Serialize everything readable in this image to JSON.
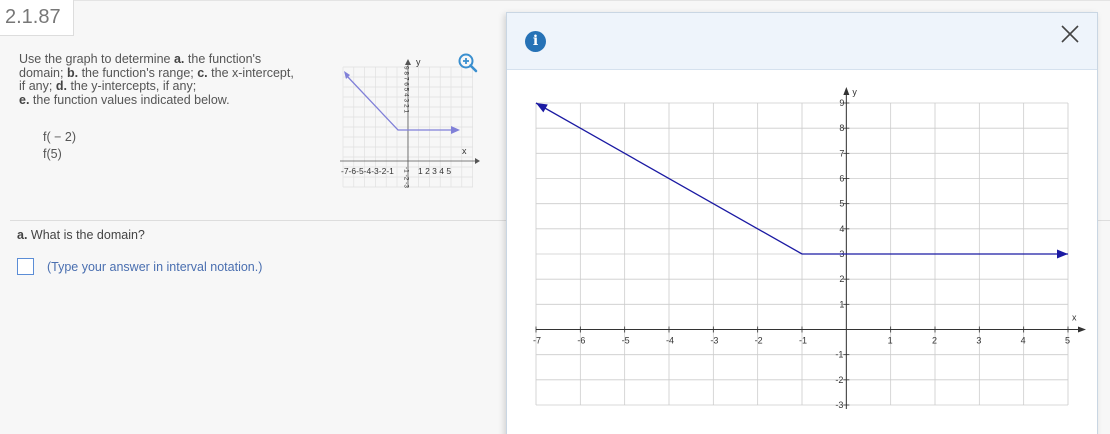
{
  "problem": {
    "number": "2.1.87"
  },
  "question": {
    "intro": "Use the graph to determine",
    "a_label": "a.",
    "a_text": "the function's domain;",
    "b_label": "b.",
    "b_text": "the function's range;",
    "c_label": "c.",
    "c_text": "the x-intercept, if any;",
    "d_label": "d.",
    "d_text": "the y-intercepts, if any;",
    "e_label": "e.",
    "e_text": "the function values indicated below.",
    "values": [
      "f( − 2)",
      "f(5)"
    ]
  },
  "part_a": {
    "label": "a.",
    "question": "What is the domain?",
    "hint": "(Type your answer in interval notation.)",
    "answer_value": ""
  },
  "icons": {
    "zoom": "zoom-in-icon",
    "info": "info-icon",
    "close": "close-icon"
  },
  "colors": {
    "line": "#1b1aa3",
    "thumb_line": "#8080d8",
    "accent": "#2672b6",
    "grid": "#cccccc"
  },
  "thumb_labels": {
    "x_label": "x",
    "y_label": "y",
    "x_ticks_neg": "-7-6-5-4-3-2-1",
    "x_ticks_pos": "1 2 3 4 5",
    "y_ticks_left": "9 8 7 6 5 4 3 2 1",
    "y_ticks_neg": "-1 -2 -3"
  },
  "chart_data": {
    "type": "line",
    "xlabel": "x",
    "ylabel": "y",
    "xlim": [
      -7,
      5
    ],
    "ylim": [
      -3,
      9
    ],
    "x_ticks": [
      "-7",
      "-6",
      "-5",
      "-4",
      "-3",
      "-2",
      "-1",
      "1",
      "2",
      "3",
      "4",
      "5"
    ],
    "y_ticks": [
      "9",
      "8",
      "7",
      "6",
      "5",
      "4",
      "3",
      "2",
      "1",
      "-1",
      "-2",
      "-3"
    ],
    "grid": true,
    "series": [
      {
        "points": [
          [
            -7,
            9
          ],
          [
            -1,
            3
          ],
          [
            5,
            3
          ]
        ],
        "arrow_left": true,
        "arrow_right": true
      }
    ]
  }
}
